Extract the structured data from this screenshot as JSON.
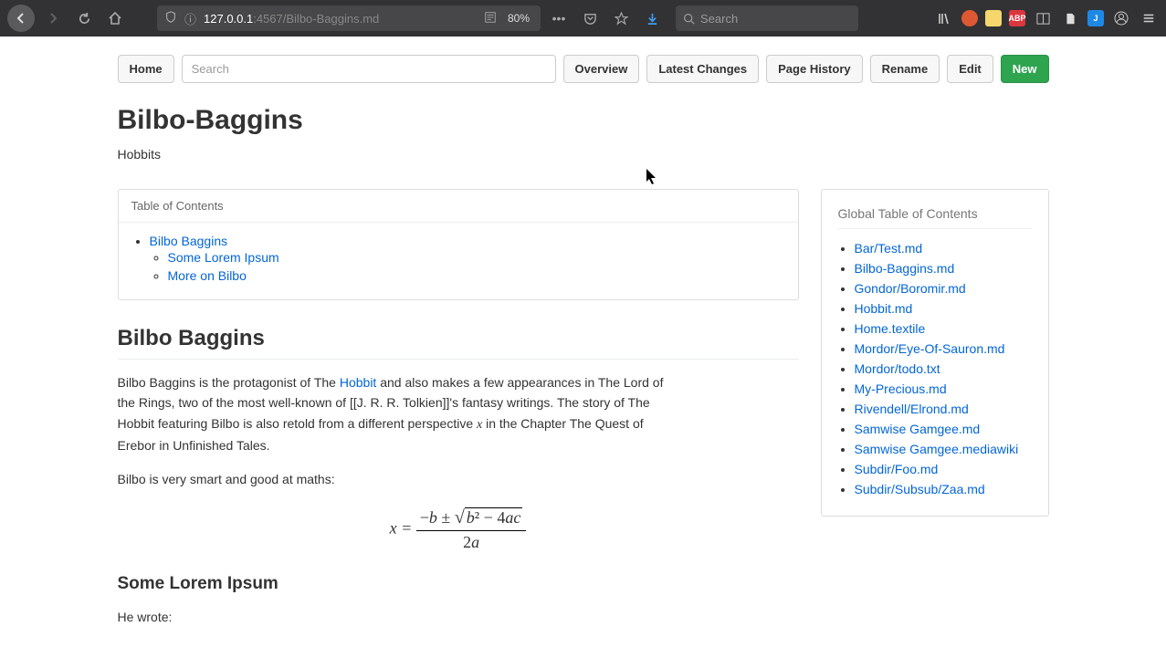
{
  "browser": {
    "url_host": "127.0.0.1",
    "url_port_path": ":4567/Bilbo-Baggins.md",
    "zoom": "80%",
    "search_placeholder": "Search"
  },
  "toolbar": {
    "home": "Home",
    "search_placeholder": "Search",
    "overview": "Overview",
    "latest_changes": "Latest Changes",
    "page_history": "Page History",
    "rename": "Rename",
    "edit": "Edit",
    "new": "New"
  },
  "page": {
    "title": "Bilbo-Baggins",
    "subtitle": "Hobbits"
  },
  "toc": {
    "header": "Table of Contents",
    "items": {
      "h1": "Bilbo Baggins",
      "h2a": "Some Lorem Ipsum",
      "h2b": "More on Bilbo"
    }
  },
  "content": {
    "h1": "Bilbo Baggins",
    "p1_a": "Bilbo Baggins is the protagonist of The ",
    "p1_link": "Hobbit",
    "p1_b": " and also makes a few appearances in The Lord of the Rings, two of the most well-known of [[J. R. R. Tolkien]]'s fantasy writings. The story of The Hobbit featuring Bilbo is also retold from a different perspective ",
    "p1_c": " in the Chapter The Quest of Erebor in Unfinished Tales.",
    "p2": "Bilbo is very smart and good at maths:",
    "h2": "Some Lorem Ipsum",
    "p3": "He wrote:"
  },
  "formula": {
    "lhs": "x =",
    "num_a": "−b ± ",
    "sqrt_body": "b² − 4ac",
    "den": "2a"
  },
  "gtoc": {
    "header": "Global Table of Contents",
    "items": [
      "Bar/Test.md",
      "Bilbo-Baggins.md",
      "Gondor/Boromir.md",
      "Hobbit.md",
      "Home.textile",
      "Mordor/Eye-Of-Sauron.md",
      "Mordor/todo.txt",
      "My-Precious.md",
      "Rivendell/Elrond.md",
      "Samwise Gamgee.md",
      "Samwise Gamgee.mediawiki",
      "Subdir/Foo.md",
      "Subdir/Subsub/Zaa.md"
    ]
  }
}
